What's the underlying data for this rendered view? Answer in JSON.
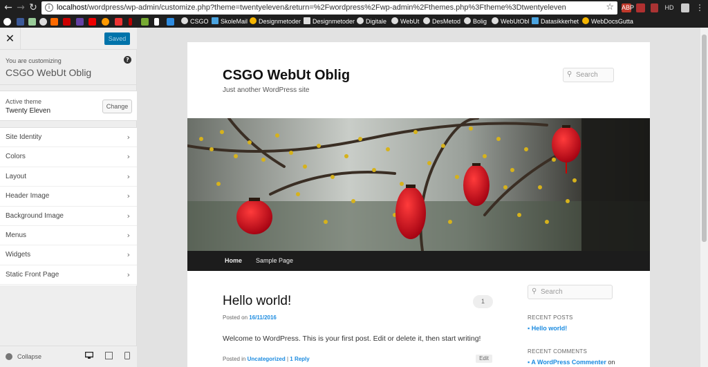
{
  "browser": {
    "url_host": "localhost",
    "url_path": "/wordpress/wp-admin/customize.php?theme=twentyeleven&return=%2Fwordpress%2Fwp-admin%2Fthemes.php%3Ftheme%3Dtwentyeleven",
    "extensions": [
      "ABP",
      "HD"
    ],
    "bookmarks": [
      "CSGO",
      "SkoleMail",
      "Designmetoder",
      "Designmetoder",
      "Digitale",
      "WebUt",
      "DesMetod",
      "Bolig",
      "WebUtObl",
      "Datasikkerhet",
      "WebDocsGutta"
    ]
  },
  "sidebar": {
    "saved_label": "Saved",
    "customizing_label": "You are customizing",
    "site_name": "CSGO WebUt Oblig",
    "active_theme_label": "Active theme",
    "theme_name": "Twenty Eleven",
    "change_label": "Change",
    "panels": [
      "Site Identity",
      "Colors",
      "Layout",
      "Header Image",
      "Background Image",
      "Menus",
      "Widgets",
      "Static Front Page"
    ],
    "collapse_label": "Collapse"
  },
  "preview": {
    "site_title": "CSGO WebUt Oblig",
    "tagline": "Just another WordPress site",
    "search_placeholder": "Search",
    "nav": [
      "Home",
      "Sample Page"
    ],
    "post": {
      "title": "Hello world!",
      "comments_count": "1",
      "posted_on_label": "Posted on",
      "date": "16/11/2016",
      "body": "Welcome to WordPress. This is your first post. Edit or delete it, then start writing!",
      "posted_in_label": "Posted in",
      "category": "Uncategorized",
      "separator": "|",
      "reply_link": "1 Reply",
      "edit_label": "Edit"
    },
    "widgets": {
      "recent_posts_title": "RECENT POSTS",
      "recent_post": "Hello world!",
      "recent_comments_title": "RECENT COMMENTS",
      "recent_commenter": "A WordPress Commenter",
      "recent_comment_tail": "on"
    }
  }
}
